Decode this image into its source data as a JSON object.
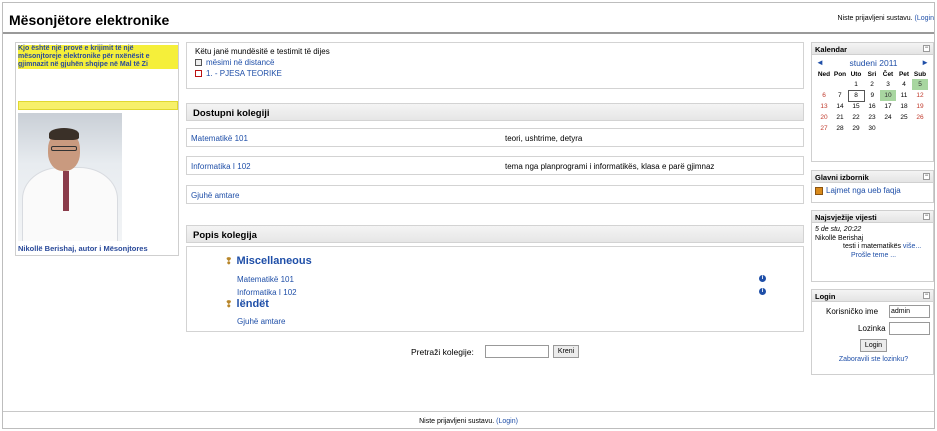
{
  "header": {
    "title": "Mësonjëtore elektronike",
    "login_info": "Niste prijavljeni sustavu.",
    "login_link": "(Login"
  },
  "left": {
    "intro": "Kjo është një provë e krijimit të një mësonjtoreje elektronike për nxënësit e gjimnazit në gjuhën shqipe në Mal të Zi",
    "caption": "Nikollë Berishaj, autor i Mësonjtores"
  },
  "test_box": {
    "intro": "Këtu janë mundësitë e testimit të dijes",
    "items": [
      "mësimi në distancë",
      "1. - PJESA TEORIKE"
    ]
  },
  "available_courses": {
    "heading": "Dostupni kolegiji",
    "rows": [
      {
        "name": "Matematikë 101",
        "desc": "teori, ushtrime, detyra"
      },
      {
        "name": "Informatika I 102",
        "desc": "tema nga planprogrami i informatikës, klasa e parë gjimnaz"
      },
      {
        "name": "Gjuhë amtare",
        "desc": ""
      }
    ]
  },
  "course_list": {
    "heading": "Popis kolegija",
    "categories": [
      {
        "name": "Miscellaneous",
        "courses": [
          "Matematikë 101",
          "Informatika I 102"
        ]
      },
      {
        "name": "lëndët",
        "courses": [
          "Gjuhë amtare"
        ]
      }
    ]
  },
  "search": {
    "label": "Pretraži kolegije:",
    "value": "",
    "button": "Kreni"
  },
  "footer": {
    "text": "Niste prijavljeni sustavu.",
    "link": "(Login)"
  },
  "calendar": {
    "title": "Kalendar",
    "month": "studeni 2011",
    "prev": "◄",
    "next": "►",
    "weekdays": [
      "Ned",
      "Pon",
      "Uto",
      "Sri",
      "Čet",
      "Pet",
      "Sub"
    ],
    "weeks": [
      [
        "",
        "",
        "1",
        "2",
        "3",
        "4",
        "5"
      ],
      [
        "6",
        "7",
        "8",
        "9",
        "10",
        "11",
        "12"
      ],
      [
        "13",
        "14",
        "15",
        "16",
        "17",
        "18",
        "19"
      ],
      [
        "20",
        "21",
        "22",
        "23",
        "24",
        "25",
        "26"
      ],
      [
        "27",
        "28",
        "29",
        "30",
        "",
        "",
        ""
      ]
    ],
    "highlight_days": [
      "5",
      "10"
    ],
    "today": "8",
    "weekend_color": "#c0392b",
    "highlight_color": "#a8d6a0"
  },
  "main_menu": {
    "title": "Glavni izbornik",
    "item": "Lajmet nga ueb faqja"
  },
  "latest_news": {
    "title": "Najsvježije vijesti",
    "date": "5 de stu, 20:22",
    "author": "Nikollë Berishaj",
    "text": "testi i matematikës",
    "more": "više...",
    "older": "Prošle teme ..."
  },
  "login": {
    "title": "Login",
    "username_label": "Korisničko ime",
    "username_value": "admin",
    "password_label": "Lozinka",
    "button": "Login",
    "forgot": "Zaboravili ste lozinku?"
  },
  "colors": {
    "link": "#1f4fa8",
    "intro_highlight": "#f5ef3a"
  }
}
